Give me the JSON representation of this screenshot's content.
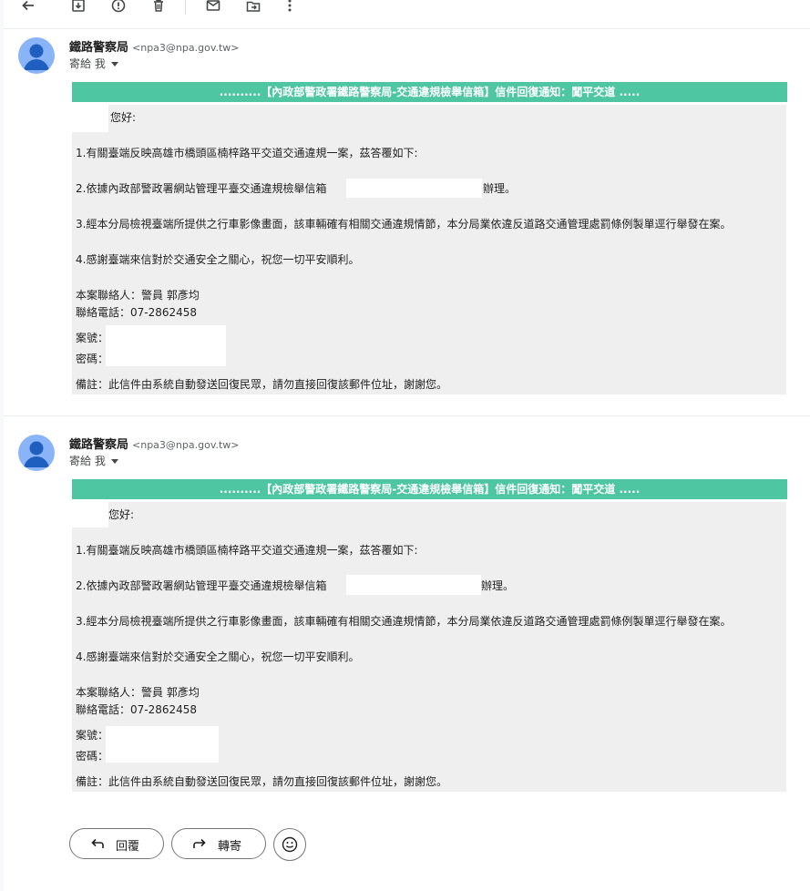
{
  "toolbar": {
    "icons": [
      "back-arrow-icon",
      "archive-icon",
      "report-spam-icon",
      "delete-icon",
      "mark-unread-icon",
      "move-to-icon",
      "more-options-icon"
    ]
  },
  "messages": [
    {
      "sender_name": "鐵路警察局",
      "sender_email": "<npa3@npa.gov.tw>",
      "recipient": "寄給 我",
      "banner": "..........【內政部警政署鐵路警察局-交通違規檢舉信箱】信件回復通知：闖平交道 .....",
      "greeting": "您好:",
      "p1": "1.有關臺端反映高雄市橋頭區楠梓路平交道交通違規一案，茲答覆如下:",
      "p2": "2.依據內政部警政署網站管理平臺交通違規檢舉信箱",
      "p2_end": "辦理。",
      "p3": "3.經本分局檢視臺端所提供之行車影像畫面，該車輛確有相關交通違規情節，本分局業依違反道路交通管理處罰條例製單逕行舉發在案。",
      "p4": "4.感謝臺端來信對於交通安全之關心，祝您一切平安順利。",
      "contact": "本案聯絡人：警員 郭彥均",
      "phone": "聯絡電話：07-2862458",
      "case_no": "案號：",
      "password": "密碼：",
      "note": "備註：此信件由系統自動發送回復民眾，請勿直接回復該郵件位址，謝謝您。"
    },
    {
      "sender_name": "鐵路警察局",
      "sender_email": "<npa3@npa.gov.tw>",
      "recipient": "寄給 我",
      "banner": "..........【內政部警政署鐵路警察局-交通違規檢舉信箱】信件回復通知：闖平交道 .....",
      "greeting": "您好:",
      "p1": "1.有關臺端反映高雄市橋頭區楠梓路平交道交通違規一案，茲答覆如下:",
      "p2": "2.依據內政部警政署網站管理平臺交通違規檢舉信箱",
      "p2_end": "辦理。",
      "p3": "3.經本分局檢視臺端所提供之行車影像畫面，該車輛確有相關交通違規情節，本分局業依違反道路交通管理處罰條例製單逕行舉發在案。",
      "p4": "4.感謝臺端來信對於交通安全之關心，祝您一切平安順利。",
      "contact": "本案聯絡人：警員 郭彥均",
      "phone": "聯絡電話：07-2862458",
      "case_no": "案號：",
      "password": "密碼：",
      "note": "備註：此信件由系統自動發送回復民眾，請勿直接回復該郵件位址，謝謝您。"
    }
  ],
  "actions": {
    "reply_label": "回覆",
    "forward_label": "轉寄",
    "emoji_icon": "emoji-smile-icon"
  },
  "colors": {
    "banner": "#4ec6a2",
    "body_bg": "#efefef",
    "avatar": "#8ab4f8"
  }
}
